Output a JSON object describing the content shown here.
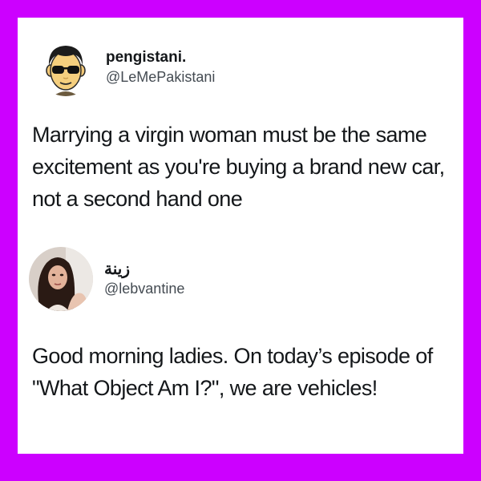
{
  "colors": {
    "background": "#cc00ff",
    "card": "#ffffff",
    "text": "#14171a",
    "handle": "#444b52"
  },
  "tweet1": {
    "display_name": "pengistani.",
    "handle": "@LeMePakistani",
    "avatar_icon": "cartoon-face-sunglasses-icon",
    "text": "Marrying a virgin woman must be the same excitement as you're buying a brand new car, not a second hand one"
  },
  "tweet2": {
    "display_name": "زينة",
    "handle": "@lebvantine",
    "avatar_icon": "profile-photo",
    "text": "Good morning ladies. On today’s episode of \"What Object Am I?\", we are vehicles!"
  }
}
